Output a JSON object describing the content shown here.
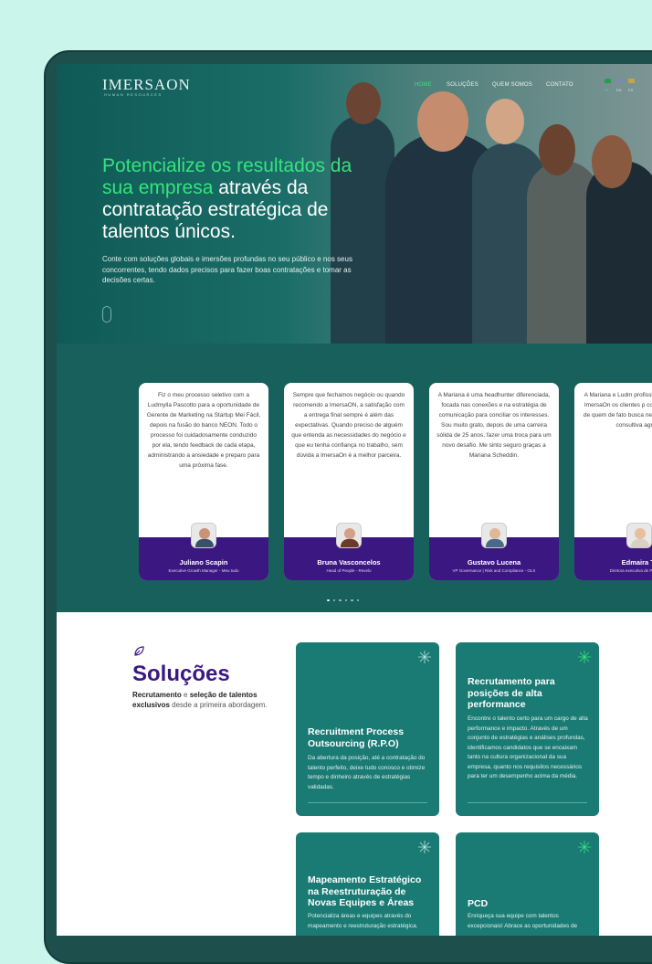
{
  "header": {
    "logo_text": "IMERSAON",
    "logo_tagline": "HUMAN RESOURCES",
    "nav": [
      "HOME",
      "SOLUÇÕES",
      "QUEM SOMOS",
      "CONTATO"
    ],
    "languages": [
      "PT",
      "EN",
      "ES"
    ]
  },
  "hero": {
    "headline_green": "Potencialize os resultados da sua empresa",
    "headline_white_1": " através da ",
    "headline_bold": "contratação estratégica",
    "headline_white_2": " de talentos únicos.",
    "paragraph": "Conte com soluções globais e imersões profundas no seu público e nos seus concorrentes, tendo dados precisos para fazer boas contratações e tomar as decisões certas."
  },
  "testimonials": [
    {
      "quote": "Fiz o meu processo seletivo com a Ludmylla Pascotto para a oportunidade de Gerente de Marketing na Startup Mei Fácil, depois na fusão do banco NEON. Todo o processo foi cuidadosamente conduzido por ela, tendo feedback de cada etapa, administrando a ansiedade e preparo para uma próxima fase.",
      "name": "Juliano Scapin",
      "role": "Executive Growth Manager - Meu tudo"
    },
    {
      "quote": "Sempre que fechamos negócio ou quando recomendo a ImersaON, a satisfação com a entrega final sempre é além das expectativas. Quando preciso de alguém que entenda as necessidades do negócio e que eu tenha confiança no trabalho, sem dúvida a ImersaOn é a melhor parceira.",
      "name": "Bruna Vasconcelos",
      "role": "Head of People - Revelo"
    },
    {
      "quote": "A Mariana é uma headhunter diferenciada, focada nas conexões e na estratégia de comunicação para conciliar os interesses. Sou muito grato, depois de uma carreira sólida de 25 anos, fazer uma troca para um novo desafio. Me sinto seguro graças a Mariana Scheddin.",
      "name": "Gustavo Lucena",
      "role": "VP Governance | Risk and Compliance - OLX"
    },
    {
      "quote": "A Mariana e Ludm profissionais diferencia ImersaOn os clientes p com uma parceira de quem de fato busca negócio para atuar consultiva agrega",
      "name": "Edmaira Tr",
      "role": "Diretora executiva de Pessoas e"
    }
  ],
  "solutions": {
    "title": "Soluções",
    "desc_bold_1": "Recrutamento",
    "desc_1": " e ",
    "desc_bold_2": "seleção de talentos exclusivos",
    "desc_2": " desde a primeira abordagem.",
    "cards": [
      {
        "title": "Recruitment Process Outsourcing (R.P.O)",
        "text": "Da abertura da posição, até a contratação do talento perfeito, deixe tudo conosco e otimize tempo e dinheiro através de estratégias validadas."
      },
      {
        "title": "Recrutamento para posições de alta performance",
        "text": "Encontre o talento certo para um cargo de alta performance e impacto. Através de um conjunto de estratégias e análises profundas, identificamos candidatos que se encaixam tanto na cultura organizacional da sua empresa, quanto nos requisitos necessários para ter um desempenho acima da média."
      },
      {
        "title": "Mapeamento Estratégico na Reestruturação de Novas Equipes e Áreas",
        "text": "Potencializa áreas e equipes através do mapeamento e reestruturação estratégica."
      },
      {
        "title": "PCD",
        "text": "Enriqueça sua equipe com talentos excepcionais! Abrace as oportunidades de"
      }
    ]
  },
  "colors": {
    "accent_green": "#37e37c",
    "brand_purple": "#3b1782",
    "teal": "#1a7a74"
  }
}
